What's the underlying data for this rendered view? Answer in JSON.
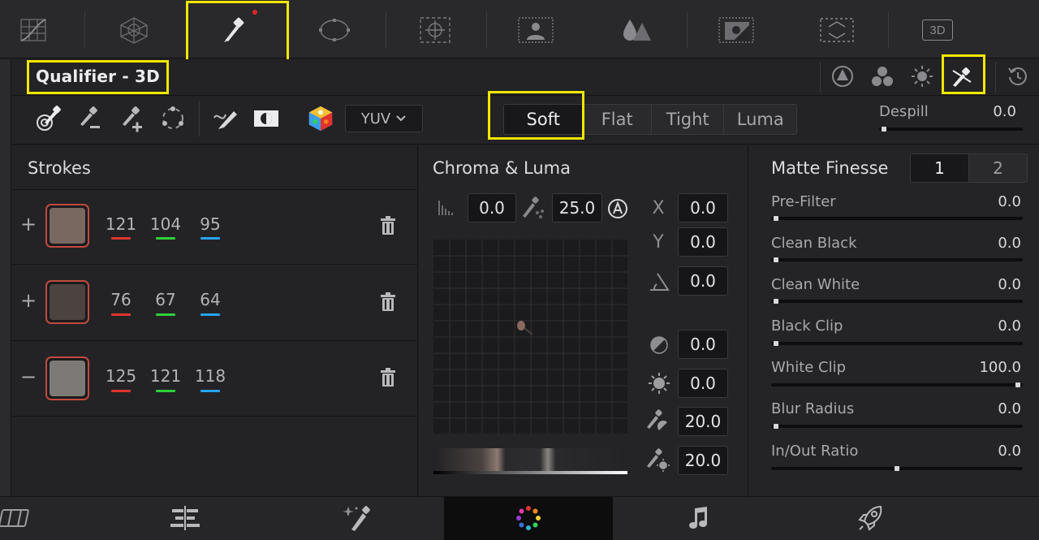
{
  "title": "Qualifier - 3D",
  "color_space": {
    "value": "YUV"
  },
  "qualifier_modes": [
    "Soft",
    "Flat",
    "Tight",
    "Luma"
  ],
  "despill": {
    "label": "Despill",
    "value": "0.0",
    "fraction": 0.0
  },
  "strokes": {
    "title": "Strokes",
    "items": [
      {
        "sign": "+",
        "r": "121",
        "g": "104",
        "b": "95",
        "color": "#796860"
      },
      {
        "sign": "+",
        "r": "76",
        "g": "67",
        "b": "64",
        "color": "#4c4340"
      },
      {
        "sign": "−",
        "r": "125",
        "g": "121",
        "b": "118",
        "color": "#7d7976"
      }
    ]
  },
  "chroma": {
    "title": "Chroma & Luma",
    "top_left": "0.0",
    "top_right": "25.0",
    "x": {
      "label": "X",
      "value": "0.0"
    },
    "y": {
      "label": "Y",
      "value": "0.0"
    },
    "angle": "0.0",
    "contrast": "0.0",
    "brightness": "0.0",
    "low_soft": "20.0",
    "high_soft": "20.0"
  },
  "matte": {
    "title": "Matte Finesse",
    "tabs": [
      "1",
      "2"
    ],
    "sliders": [
      {
        "label": "Pre-Filter",
        "value": "0.0",
        "fraction": 0.0
      },
      {
        "label": "Clean Black",
        "value": "0.0",
        "fraction": 0.0
      },
      {
        "label": "Clean White",
        "value": "0.0",
        "fraction": 0.0
      },
      {
        "label": "Black Clip",
        "value": "0.0",
        "fraction": 0.0
      },
      {
        "label": "White Clip",
        "value": "100.0",
        "fraction": 1.0
      },
      {
        "label": "Blur Radius",
        "value": "0.0",
        "fraction": 0.0
      },
      {
        "label": "In/Out Ratio",
        "value": "0.0",
        "fraction": 0.5
      }
    ]
  },
  "top_tool_icons": [
    "curves-icon",
    "color-warper-icon",
    "qualifier-icon",
    "window-icon",
    "tracker-icon",
    "magic-mask-icon",
    "blur-icon",
    "key-icon",
    "sizing-icon",
    "3d-icon"
  ],
  "top_tool_labels": {
    "threed": "3D"
  },
  "page_icons": [
    "edit-icon",
    "fairlight-timeline-icon",
    "fusion-icon",
    "color-icon",
    "fairlight-icon",
    "deliver-icon"
  ],
  "colors": {
    "highlight": "#f2e600",
    "record_dot": "#e3262b",
    "red": "#e0342f",
    "green": "#2fcf3a",
    "blue": "#27a3f0"
  }
}
